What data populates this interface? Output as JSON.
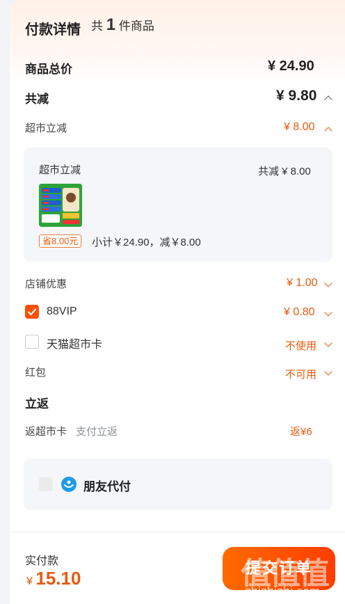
{
  "header": {
    "title": "付款详情",
    "count_prefix": "共",
    "count": "1",
    "count_suffix": "件商品"
  },
  "summary": {
    "total_label": "商品总价",
    "total_value": "¥ 24.90",
    "discount_label": "共减",
    "discount_value": "¥ 9.80"
  },
  "supermarket": {
    "label": "超市立减",
    "value": "¥ 8.00",
    "card": {
      "title": "超市立减",
      "total": "共减 ¥ 8.00",
      "save_badge": "省8.00元",
      "subtotal": "小计￥24.90，减￥8.00"
    }
  },
  "shop": {
    "label": "店铺优惠",
    "value": "¥ 1.00"
  },
  "vip": {
    "label": "88VIP",
    "value": "¥ 0.80",
    "checked": true
  },
  "tmall_card": {
    "label": "天猫超市卡",
    "value": "不使用",
    "checked": false
  },
  "red_packet": {
    "label": "红包",
    "value": "不可用"
  },
  "cashback": {
    "title": "立返",
    "label": "返超市卡",
    "sub": "支付立返",
    "value": "返¥6"
  },
  "friend_pay": {
    "label": "朋友代付"
  },
  "footer": {
    "pay_label": "实付款",
    "currency": "¥",
    "amount": "15.10",
    "submit": "提交订单"
  },
  "watermark": {
    "logo": "值值值",
    "url": "zhizhizhi.com"
  },
  "colors": {
    "accent": "#ff5000",
    "price": "#e8590c",
    "card_bg": "#f4f6f9"
  }
}
